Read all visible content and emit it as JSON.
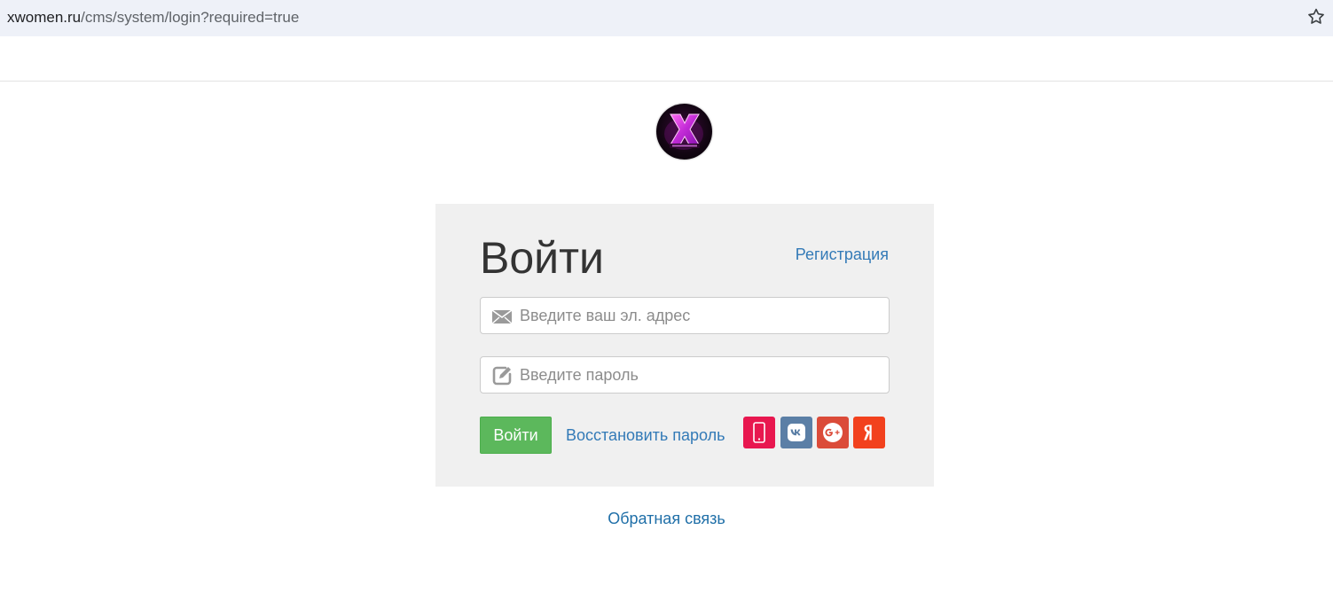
{
  "browser": {
    "url_host": "xwomen.ru",
    "url_path": "/cms/system/login?required=true"
  },
  "logo": {
    "alt": "XWOMEN",
    "mark": "X"
  },
  "login": {
    "title": "Войти",
    "register_link": "Регистрация",
    "email_placeholder": "Введите ваш эл. адрес",
    "password_placeholder": "Введите пароль",
    "submit_label": "Войти",
    "restore_link": "Восстановить пароль",
    "social": [
      {
        "name": "phone",
        "icon": "phone-icon",
        "color": "#e8174f"
      },
      {
        "name": "vk",
        "icon": "vk-icon",
        "color": "#5b7fa6"
      },
      {
        "name": "google",
        "icon": "google-plus-icon",
        "color": "#db4b39"
      },
      {
        "name": "yandex",
        "icon": "yandex-icon",
        "color": "#f2411d"
      }
    ]
  },
  "footer": {
    "feedback_link": "Обратная связь"
  },
  "colors": {
    "accent_link": "#337ab7",
    "success_button": "#5cb85c",
    "card_bg": "#f0f0f0"
  }
}
